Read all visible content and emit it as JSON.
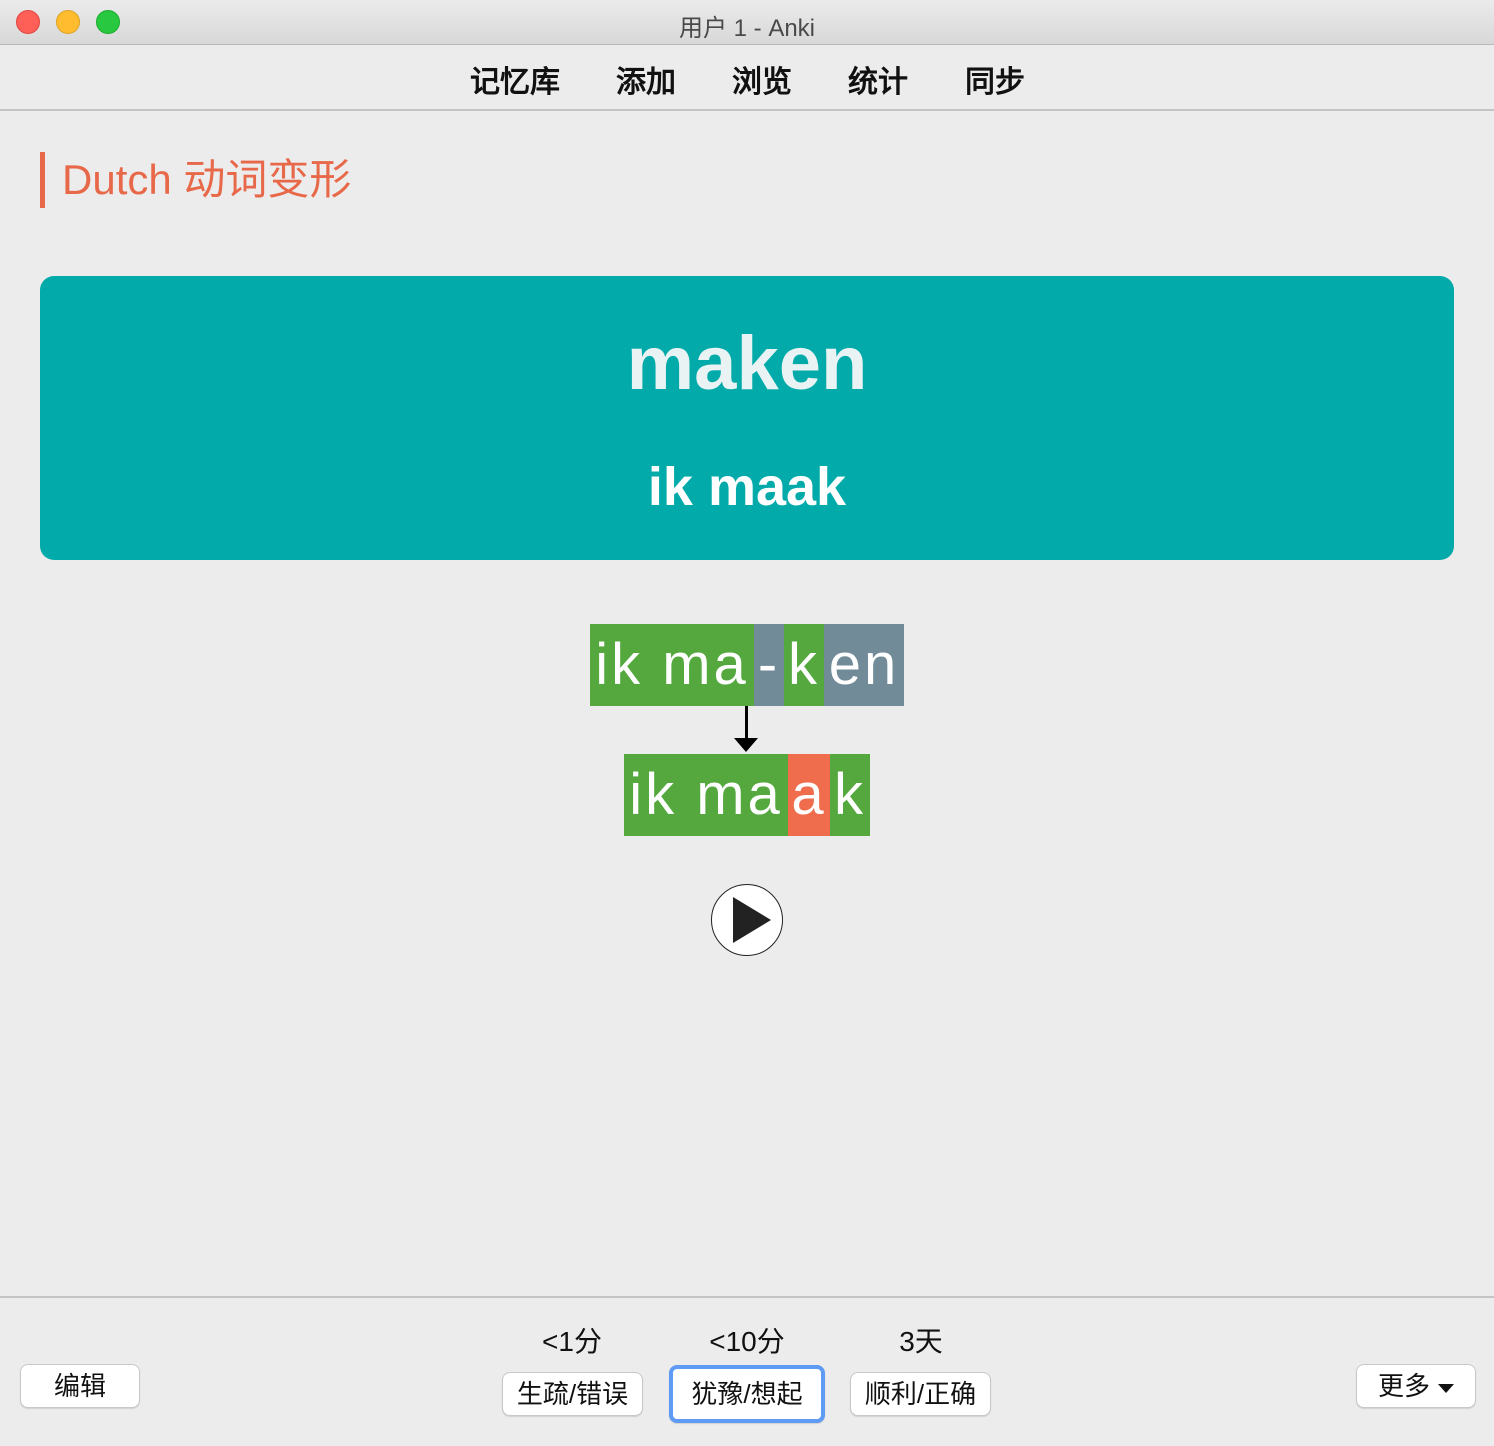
{
  "window": {
    "title": "用户 1 - Anki"
  },
  "toolbar": {
    "items": [
      "记忆库",
      "添加",
      "浏览",
      "统计",
      "同步"
    ]
  },
  "deck": {
    "title": "Dutch 动词变形"
  },
  "card": {
    "verb": "maken",
    "conjugation": "ik maak",
    "infinitive_segments": [
      "ik ma",
      "-",
      "k",
      "en"
    ],
    "result_segments": [
      "ik ma",
      "a",
      "k"
    ]
  },
  "audio": {
    "play_icon": "play-icon"
  },
  "answers": [
    {
      "due": "<1分",
      "label": "生疏/错误"
    },
    {
      "due": "<10分",
      "label": "犹豫/想起"
    },
    {
      "due": "3天",
      "label": "顺利/正确"
    }
  ],
  "bottom": {
    "edit_label": "编辑",
    "more_label": "更多"
  },
  "colors": {
    "accent": "#e8694a",
    "card_bg": "#02aaaa",
    "stem": "#54a83e",
    "suffix": "#718b98",
    "changed": "#ef6c4d",
    "focus": "#5f9af4"
  }
}
